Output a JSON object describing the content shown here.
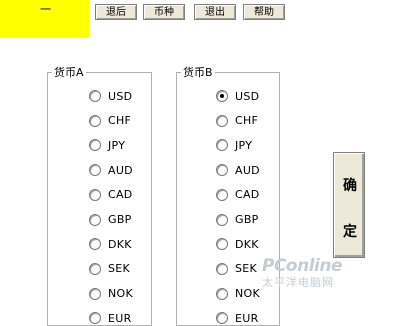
{
  "header": {
    "active_tab_label": "一",
    "buttons": [
      "退后",
      "币种",
      "退出",
      "帮助"
    ]
  },
  "currency_a": {
    "title": "货币A",
    "options": [
      "USD",
      "CHF",
      "JPY",
      "AUD",
      "CAD",
      "GBP",
      "DKK",
      "SEK",
      "NOK",
      "EUR"
    ],
    "selected": null
  },
  "currency_b": {
    "title": "货币B",
    "options": [
      "USD",
      "CHF",
      "JPY",
      "AUD",
      "CAD",
      "GBP",
      "DKK",
      "SEK",
      "NOK",
      "EUR"
    ],
    "selected": "USD"
  },
  "confirm_button": {
    "char1": "确",
    "char2": "定"
  },
  "watermark": {
    "logo": "PConline",
    "sub": "太平洋电脑网"
  },
  "colors": {
    "highlight": "#ffff00",
    "button_face": "#ece9d8"
  }
}
